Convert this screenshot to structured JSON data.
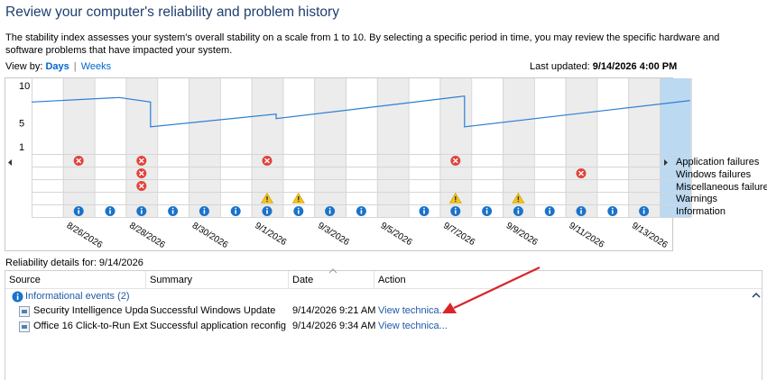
{
  "header": {
    "title": "Review your computer's reliability and problem history",
    "description": "The stability index assesses your system's overall stability on a scale from 1 to 10. By selecting a specific period in time, you may review the specific hardware and software problems that have impacted your system.",
    "view_by_label": "View by:",
    "view_days": "Days",
    "view_sep": "|",
    "view_weeks": "Weeks",
    "last_updated_label": "Last updated:",
    "last_updated_value": "9/14/2026 4:00 PM"
  },
  "chart_data": {
    "type": "line",
    "y_ticks": [
      "10",
      "5",
      "1"
    ],
    "ylim": [
      1,
      10
    ],
    "x_date_labels": [
      "8/26/2026",
      "8/28/2026",
      "8/30/2026",
      "9/1/2026",
      "9/3/2026",
      "9/5/2026",
      "9/7/2026",
      "9/9/2026",
      "9/11/2026",
      "9/13/2026"
    ],
    "days": [
      "8/25/2026",
      "8/26/2026",
      "8/27/2026",
      "8/28/2026",
      "8/29/2026",
      "8/30/2026",
      "8/31/2026",
      "9/1/2026",
      "9/2/2026",
      "9/3/2026",
      "9/4/2026",
      "9/5/2026",
      "9/6/2026",
      "9/7/2026",
      "9/8/2026",
      "9/9/2026",
      "9/10/2026",
      "9/11/2026",
      "9/12/2026",
      "9/13/2026",
      "9/14/2026"
    ],
    "selected_day": "9/14/2026",
    "stability_index": [
      {
        "x": "8/25/2026",
        "y": 7.8
      },
      {
        "x": "8/27/2026",
        "y": 8.4
      },
      {
        "x": "8/28/2026",
        "y": 7.8
      },
      {
        "x": "8/28/2026",
        "y": 4.5
      },
      {
        "x": "9/1/2026",
        "y": 6.2
      },
      {
        "x": "9/1/2026",
        "y": 5.6
      },
      {
        "x": "9/7/2026",
        "y": 8.6
      },
      {
        "x": "9/7/2026",
        "y": 4.5
      },
      {
        "x": "9/14/2026",
        "y": 8.0
      }
    ],
    "rows": [
      "Application failures",
      "Windows failures",
      "Miscellaneous failures",
      "Warnings",
      "Information"
    ],
    "events": {
      "Application failures": [
        "8/26/2026",
        "8/28/2026",
        "9/1/2026",
        "9/7/2026"
      ],
      "Windows failures": [
        "8/28/2026",
        "9/11/2026"
      ],
      "Miscellaneous failures": [
        "8/28/2026"
      ],
      "Warnings": [
        "9/1/2026",
        "9/2/2026",
        "9/7/2026",
        "9/9/2026"
      ],
      "Information": [
        "8/26/2026",
        "8/27/2026",
        "8/28/2026",
        "8/29/2026",
        "8/30/2026",
        "8/31/2026",
        "9/1/2026",
        "9/2/2026",
        "9/3/2026",
        "9/4/2026",
        "9/6/2026",
        "9/7/2026",
        "9/8/2026",
        "9/9/2026",
        "9/10/2026",
        "9/11/2026",
        "9/12/2026",
        "9/13/2026"
      ]
    },
    "colors": {
      "line": "#2a7fd4",
      "selected": "#bcd9f2",
      "shaded": "#ececec",
      "error": "#e0433b",
      "warning": "#f5c31c",
      "info": "#1a73c9"
    }
  },
  "details": {
    "label": "Reliability details for: 9/14/2026",
    "columns": [
      "Source",
      "Summary",
      "Date",
      "Action"
    ],
    "group_label": "Informational events (2)",
    "rows": [
      {
        "source": "Security Intelligence Upda...",
        "summary": "Successful Windows Update",
        "date": "9/14/2026 9:21 AM",
        "action": "View technica..."
      },
      {
        "source": "Office 16 Click-to-Run Ext...",
        "summary": "Successful application reconfig...",
        "date": "9/14/2026 9:34 AM",
        "action": "View technica..."
      }
    ]
  }
}
